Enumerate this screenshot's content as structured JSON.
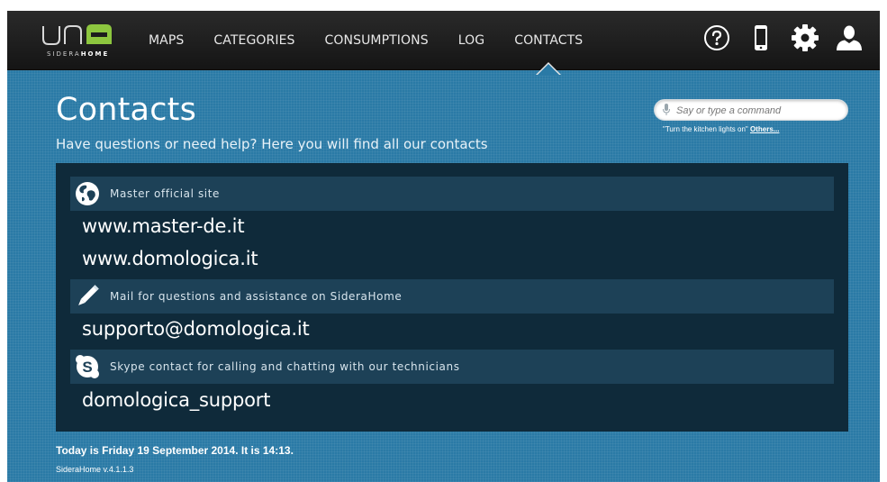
{
  "app": {
    "logo_text": "una",
    "logo_sub_prefix": "SIDERA",
    "logo_sub_suffix": "HOME",
    "brand_color": "#8dc63f"
  },
  "nav": {
    "items": [
      {
        "label": "MAPS"
      },
      {
        "label": "CATEGORIES"
      },
      {
        "label": "CONSUMPTIONS"
      },
      {
        "label": "LOG"
      },
      {
        "label": "CONTACTS",
        "active": true
      }
    ]
  },
  "top_icons": [
    "help-icon",
    "mobile-phone-icon",
    "settings-gear-icon",
    "user-icon"
  ],
  "page": {
    "title": "Contacts",
    "subtitle": "Have questions or need help? Here you will find all our contacts"
  },
  "voice": {
    "placeholder": "Say or type a command",
    "hint": "\"Turn the kitchen lights on\"",
    "others_link": "Others..."
  },
  "sections": [
    {
      "icon": "globe-icon",
      "label": "Master official site",
      "items": [
        "www.master-de.it",
        "www.domologica.it"
      ]
    },
    {
      "icon": "pencil-icon",
      "label": "Mail for questions and assistance on SideraHome",
      "items": [
        "supporto@domologica.it"
      ]
    },
    {
      "icon": "skype-icon",
      "label": "Skype contact for calling and chatting with our technicians",
      "items": [
        "domologica_support"
      ]
    }
  ],
  "footer": {
    "date_text": "Today is Friday 19 September 2014. It is 14:13.",
    "version": "SideraHome v.4.1.1.3"
  },
  "colors": {
    "background": "#2a7aa6",
    "topbar": "#1c1c1c",
    "panel": "#0f2a3a",
    "section_header": "#1d4157"
  }
}
